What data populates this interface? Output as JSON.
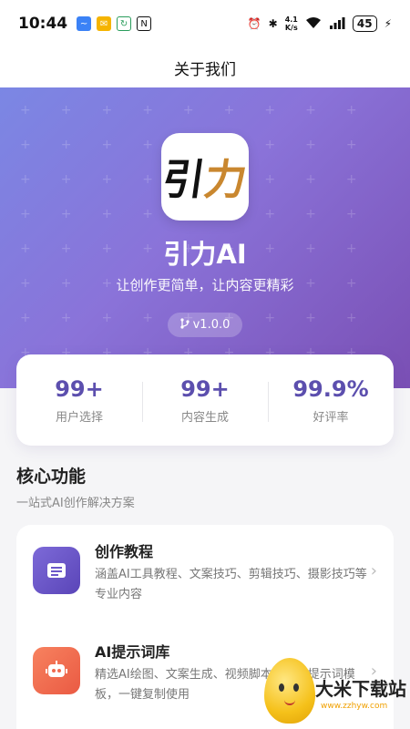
{
  "status_bar": {
    "time": "10:44",
    "network_speed_top": "4.1",
    "network_speed_bottom": "K/s",
    "battery": "45"
  },
  "nav": {
    "title": "关于我们"
  },
  "hero": {
    "logo_text_main": "引",
    "logo_text_accent": "力",
    "app_name": "引力AI",
    "slogan": "让创作更简单，让内容更精彩",
    "version": "v1.0.0"
  },
  "stats": [
    {
      "value": "99+",
      "label": "用户选择"
    },
    {
      "value": "99+",
      "label": "内容生成"
    },
    {
      "value": "99.9%",
      "label": "好评率"
    }
  ],
  "section": {
    "title": "核心功能",
    "subtitle": "一站式AI创作解决方案"
  },
  "features": [
    {
      "title": "创作教程",
      "description": "涵盖AI工具教程、文案技巧、剪辑技巧、摄影技巧等专业内容",
      "icon": "book-icon",
      "color": "#6b57c9"
    },
    {
      "title": "AI提示词库",
      "description": "精选AI绘图、文案生成、视频脚本等多类提示词模板，一键复制使用",
      "icon": "robot-icon",
      "color": "#f06a4f"
    }
  ],
  "watermark": {
    "text": "大米下载站",
    "url": "www.zzhyw.com"
  },
  "colors": {
    "hero_start": "#7b87e4",
    "hero_end": "#7a4fb4",
    "stat_accent": "#5c4fae"
  }
}
